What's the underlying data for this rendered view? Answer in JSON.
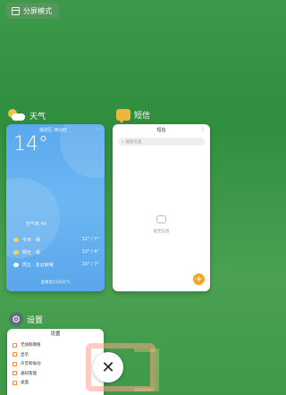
{
  "split_screen": {
    "label": "分屏模式"
  },
  "apps": {
    "weather": {
      "label": "天气",
      "card": {
        "location": "海淀区 西北旺",
        "temperature": "14°",
        "info": "空气良 40",
        "rows": [
          {
            "day": "今天 · 晴",
            "range": "12° / 7°",
            "icon": "sun-icon"
          },
          {
            "day": "明天 · 晴",
            "range": "12° / 4°",
            "icon": "sun-icon"
          },
          {
            "day": "周五 · 多云转晴",
            "range": "15° / 7°",
            "icon": "cloud-icon"
          }
        ],
        "link": "查看近15日天气"
      }
    },
    "sms": {
      "label": "短信",
      "card": {
        "title": "短信",
        "search_placeholder": "搜索信息",
        "empty_text": "暂无信息",
        "fab_symbol": "+"
      }
    },
    "settings": {
      "label": "设置",
      "card": {
        "title": "设置",
        "items": [
          "无线和网络",
          "显示",
          "声音和振动",
          "通知管理",
          "桌面"
        ]
      }
    }
  },
  "close_button": {
    "symbol": "✕"
  },
  "colors": {
    "background": "#3c9a4a",
    "weather_card": "#5aa9ef",
    "accent_orange": "#f6a623"
  }
}
